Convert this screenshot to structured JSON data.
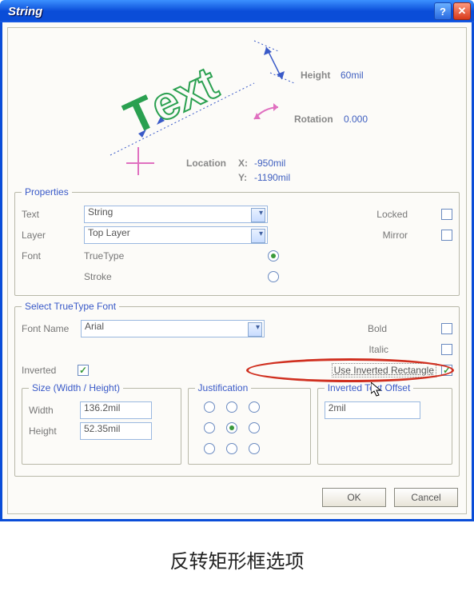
{
  "window": {
    "title": "String"
  },
  "preview": {
    "height_label": "Height",
    "height_value": "60mil",
    "rotation_label": "Rotation",
    "rotation_value": "0.000",
    "location_label": "Location",
    "x_label": "X:",
    "x_value": "-950mil",
    "y_label": "Y:",
    "y_value": "-1190mil"
  },
  "properties": {
    "legend": "Properties",
    "text_label": "Text",
    "text_value": "String",
    "layer_label": "Layer",
    "layer_value": "Top Layer",
    "font_label": "Font",
    "font_truetype": "TrueType",
    "font_stroke": "Stroke",
    "locked_label": "Locked",
    "mirror_label": "Mirror"
  },
  "truetype": {
    "legend": "Select TrueType Font",
    "fontname_label": "Font Name",
    "fontname_value": "Arial",
    "bold_label": "Bold",
    "italic_label": "Italic"
  },
  "inverted": {
    "inverted_label": "Inverted",
    "use_rect_label": "Use Inverted Rectangle",
    "size_legend": "Size (Width / Height)",
    "width_label": "Width",
    "width_value": "136.2mil",
    "height_label": "Height",
    "height_value": "52.35mil",
    "just_legend": "Justification",
    "offset_legend": "Inverted Text Offset",
    "offset_value": "2mil"
  },
  "buttons": {
    "ok": "OK",
    "cancel": "Cancel"
  },
  "caption": "反转矩形框选项"
}
